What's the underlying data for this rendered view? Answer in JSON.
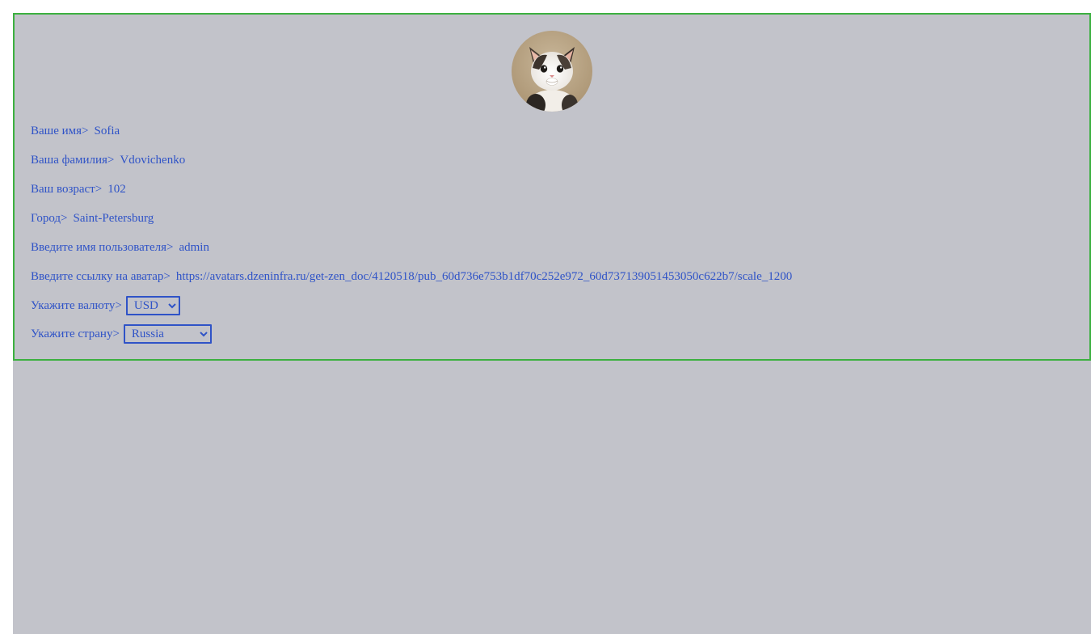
{
  "profile": {
    "avatar_alt": "avatar",
    "fields": [
      {
        "label": "Ваше имя>",
        "value": "Sofia"
      },
      {
        "label": "Ваша фамилия>",
        "value": "Vdovichenko"
      },
      {
        "label": "Ваш возраст>",
        "value": "102"
      },
      {
        "label": "Город>",
        "value": "Saint-Petersburg"
      },
      {
        "label": "Введите имя пользователя>",
        "value": "admin"
      },
      {
        "label": "Введите ссылку на аватар>",
        "value": "https://avatars.dzeninfra.ru/get-zen_doc/4120518/pub_60d736e753b1df70c252e972_60d737139051453050c622b7/scale_1200"
      }
    ],
    "currency": {
      "label": "Укажите валюту>",
      "selected": "USD",
      "options": [
        "USD"
      ]
    },
    "country": {
      "label": "Укажите страну>",
      "selected": "Russia",
      "options": [
        "Russia"
      ]
    }
  },
  "colors": {
    "background": "#c2c3ca",
    "border": "#3cb040",
    "text": "#2f53c7"
  }
}
